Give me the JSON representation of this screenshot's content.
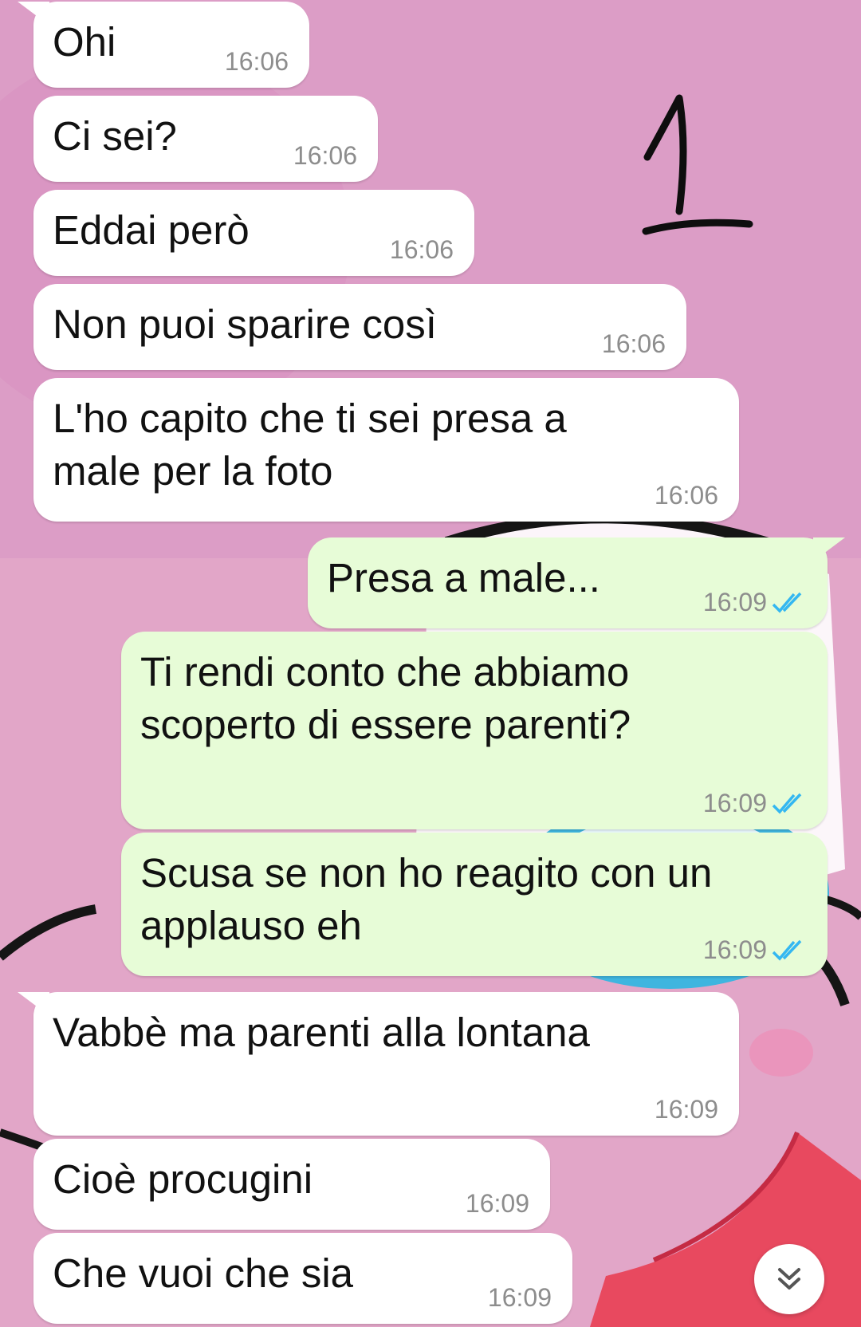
{
  "colors": {
    "wallpaper_pink": "#e2a6c8",
    "incoming_bubble": "#ffffff",
    "outgoing_bubble": "#e7fcd7",
    "timestamp": "#8d8d8d",
    "read_ticks": "#34b7f1"
  },
  "messages": [
    {
      "direction": "in",
      "text": "Ohi",
      "time": "16:06"
    },
    {
      "direction": "in",
      "text": "Ci sei?",
      "time": "16:06"
    },
    {
      "direction": "in",
      "text": "Eddai però",
      "time": "16:06"
    },
    {
      "direction": "in",
      "text": "Non puoi sparire così",
      "time": "16:06"
    },
    {
      "direction": "in",
      "text": "L'ho capito che ti sei presa a\nmale per la foto",
      "time": "16:06"
    },
    {
      "direction": "out",
      "text": "Presa a male...",
      "time": "16:09",
      "status_icon": "double-check-read-icon"
    },
    {
      "direction": "out",
      "text": "Ti rendi conto che abbiamo\nscoperto di essere parenti?",
      "time": "16:09",
      "status_icon": "double-check-read-icon"
    },
    {
      "direction": "out",
      "text": "Scusa se non ho reagito con un\napplauso eh",
      "time": "16:09",
      "status_icon": "double-check-read-icon"
    },
    {
      "direction": "in",
      "text": "Vabbè ma parenti alla lontana",
      "time": "16:09"
    },
    {
      "direction": "in",
      "text": "Cioè procugini",
      "time": "16:09"
    },
    {
      "direction": "in",
      "text": "Che vuoi che sia",
      "time": "16:09"
    }
  ],
  "scroll_button": {
    "icon": "double-chevron-down-icon"
  }
}
